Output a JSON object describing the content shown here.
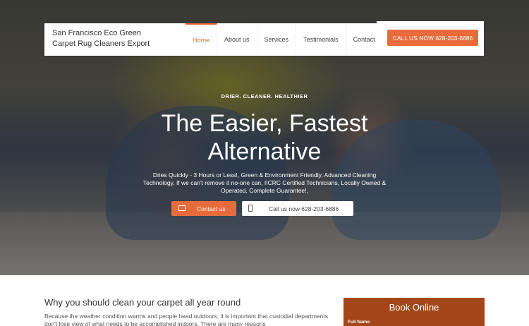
{
  "header": {
    "brand": "San Francisco Eco Green Carpet Rug Cleaners Export",
    "nav": [
      "Home",
      "About us",
      "Services",
      "Testimonials",
      "Contact"
    ],
    "active_nav": "Home",
    "call_button": "CALL US NOW 628-203-6886"
  },
  "hero": {
    "eyebrow": "DRIER. CLEANER. HEALTHIER",
    "headline": "The Easier, Fastest Alternative",
    "subtext": "Dries Quickly - 3 Hours or Less!, Green & Environment Friendly, Advanced Cleaning Technology, If we can't remove it no-one can, IICRC Certified Technicians, Locally Owned & Operated, Complete Guarantee!,",
    "contact_button": "Contact us",
    "call_button": "Call us now 628-203-6886"
  },
  "content": {
    "title": "Why you should clean your carpet all year round",
    "body": "Because the weather condition warms and people head outdoors, it is important that custodial departments don't lose view of what needs to be accomplished indoors. There are many reasons"
  },
  "booking": {
    "title": "Book Online",
    "full_name_label": "Full Name"
  },
  "colors": {
    "accent": "#e86c3b",
    "panel": "#a3471b"
  },
  "icons": {
    "contact": "envelope-icon",
    "call": "phone-icon"
  }
}
